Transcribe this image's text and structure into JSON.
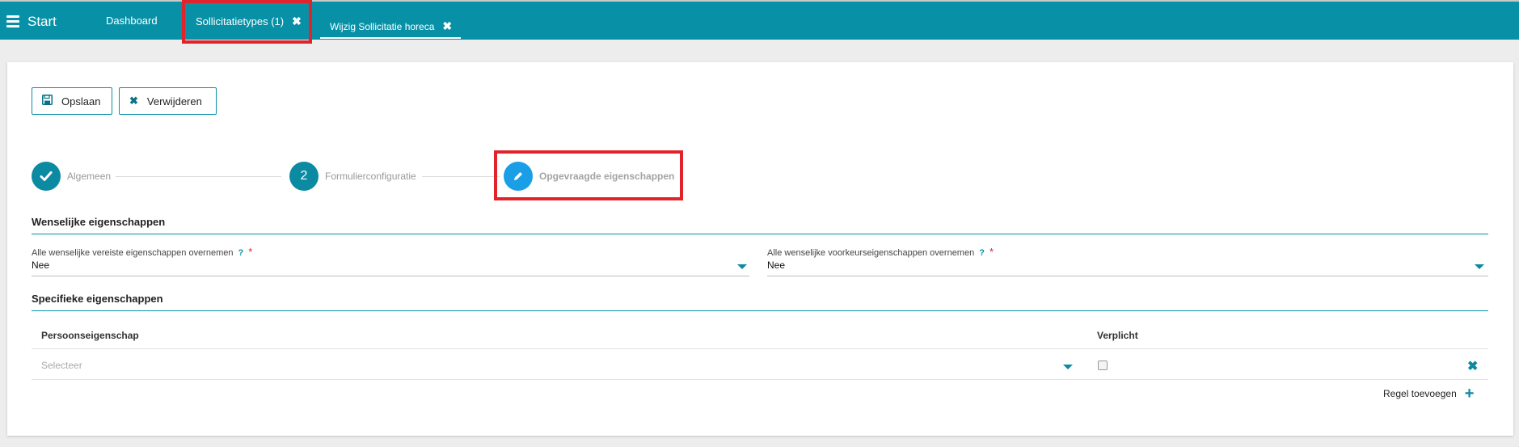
{
  "topbar": {
    "start_label": "Start",
    "tabs": [
      {
        "label": "Dashboard",
        "closable": false
      },
      {
        "label": "Sollicitatietypes (1)",
        "closable": true
      },
      {
        "label": "Wijzig Sollicitatie horeca",
        "closable": true,
        "active": true
      }
    ],
    "close_glyph": "✖"
  },
  "toolbar": {
    "save_label": "Opslaan",
    "delete_label": "Verwijderen"
  },
  "stepper": {
    "steps": [
      {
        "label": "Algemeen",
        "state": "done",
        "icon": "check-icon"
      },
      {
        "label": "Formulierconfiguratie",
        "state": "numbered",
        "number": "2"
      },
      {
        "label": "Opgevraagde eigenschappen",
        "state": "current",
        "icon": "pencil-icon"
      }
    ]
  },
  "desired": {
    "title": "Wenselijke eigenschappen",
    "fields": [
      {
        "label": "Alle wenselijke vereiste eigenschappen overnemen",
        "help": "?",
        "required": "*",
        "value": "Nee"
      },
      {
        "label": "Alle wenselijke voorkeurseigenschappen overnemen",
        "help": "?",
        "required": "*",
        "value": "Nee"
      }
    ]
  },
  "specific": {
    "title": "Specifieke eigenschappen",
    "columns": [
      "Persoonseigenschap",
      "Verplicht"
    ],
    "rows": [
      {
        "placeholder": "Selecteer",
        "required": false
      }
    ],
    "add_row_label": "Regel toevoegen"
  },
  "colors": {
    "brand": "#0891a6",
    "highlight": "#e1242c",
    "step_current": "#1a9ee5"
  }
}
